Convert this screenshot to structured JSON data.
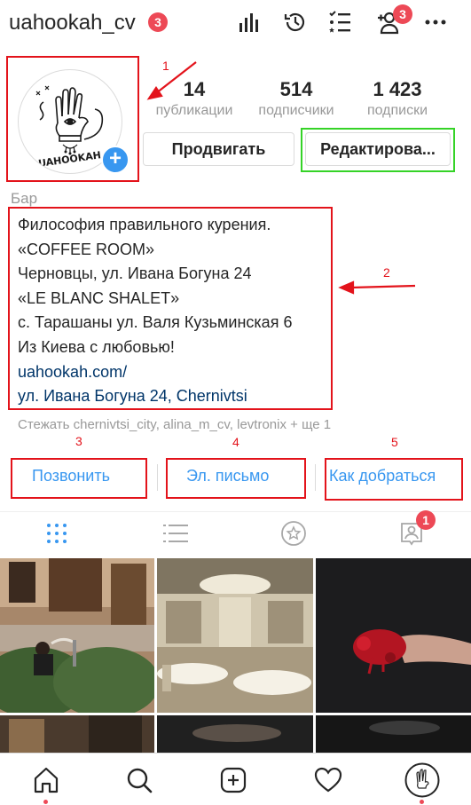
{
  "header": {
    "username": "uahookah_cv",
    "username_badge": "3",
    "people_badge": "3",
    "icons": [
      "bar-chart-icon",
      "history-icon",
      "list-icon",
      "add-person-icon",
      "more-icon"
    ]
  },
  "profile": {
    "avatar_label": "UAHOOKAH",
    "stats": [
      {
        "value": "14",
        "label": "публикации"
      },
      {
        "value": "514",
        "label": "подписчики"
      },
      {
        "value": "1 423",
        "label": "подписки"
      }
    ],
    "promote_label": "Продвигать",
    "edit_label": "Редактирова..."
  },
  "bio": {
    "category": "Бар",
    "lines": [
      "Философия правильного курения.",
      "«COFFEE ROOM»",
      "Черновцы, ул. Ивана Богуна 24",
      "«LE BLANC SHALET»",
      "с. Тарашаны ул. Валя Кузьминская 6",
      "Из Киева с любовью!"
    ],
    "website": "uahookah.com/",
    "address": "ул. Ивана Богуна 24, Chernivtsi",
    "followed_by": "Стежать chernivtsi_city, alina_m_cv, levtronix + ще 1"
  },
  "actions": {
    "call": "Позвонить",
    "email": "Эл. письмо",
    "directions": "Как добраться"
  },
  "annotations": {
    "n1": "1",
    "n2": "2",
    "n3": "3",
    "n4": "4",
    "n5": "5"
  },
  "tabs": {
    "tagged_badge": "1"
  },
  "colors": {
    "accent": "#3897f0",
    "badge": "#ed4956",
    "annotation_red": "#e3131b",
    "annotation_green": "#35d327",
    "link_dark": "#003569"
  }
}
